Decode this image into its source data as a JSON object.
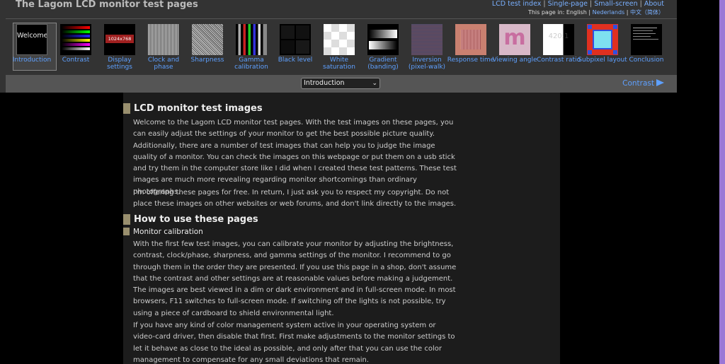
{
  "header": {
    "title": "The Lagom LCD monitor test pages",
    "top_links": [
      "LCD test index",
      "Single-page",
      "Small-screen",
      "About"
    ],
    "lang_label": "This page in:",
    "lang_current": "English",
    "lang_links": [
      "Nederlands",
      "中文（简体）"
    ]
  },
  "thumbs": [
    {
      "label": "Introduction",
      "image": "Welcome"
    },
    {
      "label": "Contrast"
    },
    {
      "label": "Display settings",
      "image": "1024x768"
    },
    {
      "label": "Clock and phase"
    },
    {
      "label": "Sharpness"
    },
    {
      "label": "Gamma calibration"
    },
    {
      "label": "Black level"
    },
    {
      "label": "White saturation"
    },
    {
      "label": "Gradient (banding)"
    },
    {
      "label": "Inversion (pixel-walk)"
    },
    {
      "label": "Response time"
    },
    {
      "label": "Viewing angle",
      "image": "m"
    },
    {
      "label": "Contrast ratio",
      "image": "420:1"
    },
    {
      "label": "Subpixel layout"
    },
    {
      "label": "Conclusion"
    }
  ],
  "nav": {
    "select_value": "Introduction",
    "next_label": "Contrast"
  },
  "content": {
    "h_intro": "LCD monitor test images",
    "p1": "Welcome to the Lagom LCD monitor test pages. With the test images on these pages, you can easily adjust the settings of your monitor to get the best possible picture quality. Additionally, there are a number of test images that can help you to judge the image quality of a monitor. You can check the images on this webpage or put them on a usb stick and try them in the computer store like I did when I created these test patterns. These test images are much more revealing regarding monitor shortcomings than ordinary photographs.",
    "p2": "I'm offering these pages for free. In return, I just ask you to respect my copyright. Do not place these images on other websites or web forums, and don't link directly to the images.",
    "h_howto": "How to use these pages",
    "h_calib": "Monitor calibration",
    "p3": "With the first few test images, you can calibrate your monitor by adjusting the brightness, contrast, clock/phase, sharpness, and gamma settings of the monitor. I recommend to go through them in the order they are presented. If you use this page in a shop, don't assume that the contrast and other settings are at reasonable values before making a judgement. The images are best viewed in a dim or dark environment and in full-screen mode. In most browsers, F11 switches to full-screen mode. If switching off the lights is not possible, try using a piece of cardboard to shield environmental light.",
    "p4": "If you have any kind of color management system active in your operating system or video-card driver, then disable that first. First make adjustments to the monitor settings to let it behave as close to the ideal as possible, and only after that you can use the color management to compensate for any small deviations that remain."
  }
}
